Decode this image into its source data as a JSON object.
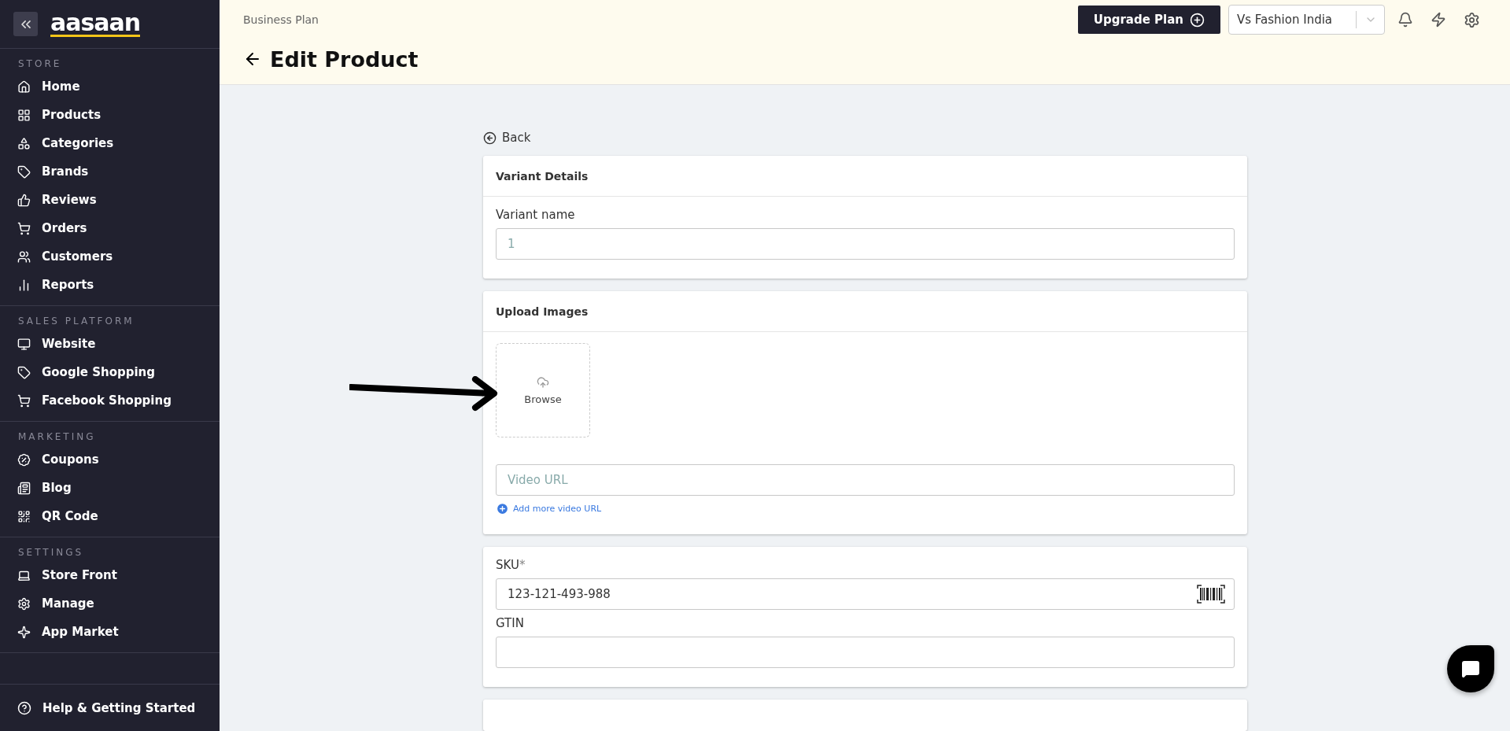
{
  "sidebar": {
    "logo": "aasaan",
    "sections": [
      {
        "title": "STORE",
        "items": [
          {
            "label": "Home"
          },
          {
            "label": "Products"
          },
          {
            "label": "Categories"
          },
          {
            "label": "Brands"
          },
          {
            "label": "Reviews"
          },
          {
            "label": "Orders"
          },
          {
            "label": "Customers"
          },
          {
            "label": "Reports"
          }
        ]
      },
      {
        "title": "SALES PLATFORM",
        "items": [
          {
            "label": "Website"
          },
          {
            "label": "Google Shopping"
          },
          {
            "label": "Facebook Shopping"
          }
        ]
      },
      {
        "title": "MARKETING",
        "items": [
          {
            "label": "Coupons"
          },
          {
            "label": "Blog"
          },
          {
            "label": "QR Code"
          }
        ]
      },
      {
        "title": "SETTINGS",
        "items": [
          {
            "label": "Store Front"
          },
          {
            "label": "Manage"
          },
          {
            "label": "App Market"
          }
        ]
      }
    ],
    "help": "Help & Getting Started"
  },
  "header": {
    "plan": "Business Plan",
    "upgrade": "Upgrade Plan",
    "store": "Vs Fashion India",
    "title": "Edit Product"
  },
  "back": "Back",
  "variant_card": {
    "title": "Variant Details",
    "label": "Variant name",
    "placeholder": "1"
  },
  "upload_card": {
    "title": "Upload Images",
    "browse": "Browse",
    "video_placeholder": "Video URL",
    "add_video": "Add more video URL"
  },
  "sku_card": {
    "sku_label": "SKU",
    "required": "*",
    "sku_value": "123-121-493-988",
    "gtin_label": "GTIN"
  }
}
